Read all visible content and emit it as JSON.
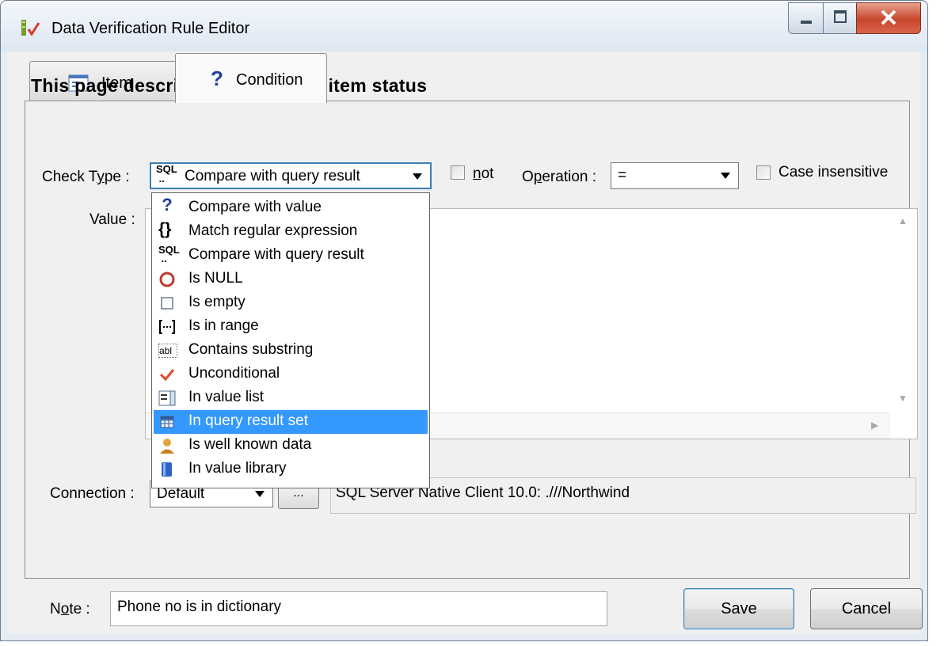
{
  "window": {
    "title": "Data Verification Rule Editor"
  },
  "tabs": [
    {
      "label": "Item"
    },
    {
      "label": "Condition"
    }
  ],
  "heading": "This page describes correct data item status",
  "check_type": {
    "label_pre": "Check T",
    "label_ul": "y",
    "label_post": "pe :",
    "selected": "Compare with query result"
  },
  "not_option": {
    "label_ul": "n",
    "label_post": "ot",
    "checked": false
  },
  "operation": {
    "label_pre": "O",
    "label_ul": "p",
    "label_post": "eration :",
    "selected": "="
  },
  "case_insensitive": {
    "label": "Case insensitive",
    "checked": false
  },
  "value": {
    "label": "Value :"
  },
  "check_type_options": [
    {
      "label": "Compare with value",
      "icon": "question-icon",
      "selected": false
    },
    {
      "label": "Match regular expression",
      "icon": "braces-icon",
      "selected": false
    },
    {
      "label": "Compare with query result",
      "icon": "sql-icon",
      "selected": false
    },
    {
      "label": "Is NULL",
      "icon": "null-circle-icon",
      "selected": false
    },
    {
      "label": "Is empty",
      "icon": "empty-box-icon",
      "selected": false
    },
    {
      "label": "Is in range",
      "icon": "range-icon",
      "selected": false
    },
    {
      "label": "Contains substring",
      "icon": "substring-icon",
      "selected": false
    },
    {
      "label": "Unconditional",
      "icon": "checkmark-icon",
      "selected": false
    },
    {
      "label": "In value list",
      "icon": "value-list-icon",
      "selected": false
    },
    {
      "label": "In query result set",
      "icon": "grid-icon",
      "selected": true
    },
    {
      "label": "Is well known data",
      "icon": "person-icon",
      "selected": false
    },
    {
      "label": "In value library",
      "icon": "book-icon",
      "selected": false
    }
  ],
  "connection": {
    "label": "Connection :",
    "selected": "Default",
    "browse_label": "...",
    "info": "SQL Server Native Client 10.0: .///Northwind"
  },
  "note": {
    "label_pre": "N",
    "label_ul": "o",
    "label_post": "te :",
    "value": "Phone no is in dictionary"
  },
  "buttons": {
    "save": "Save",
    "cancel": "Cancel"
  },
  "colors": {
    "selection": "#3399ff",
    "close_button": "#c7462c",
    "frame": "#e6ecf4"
  }
}
